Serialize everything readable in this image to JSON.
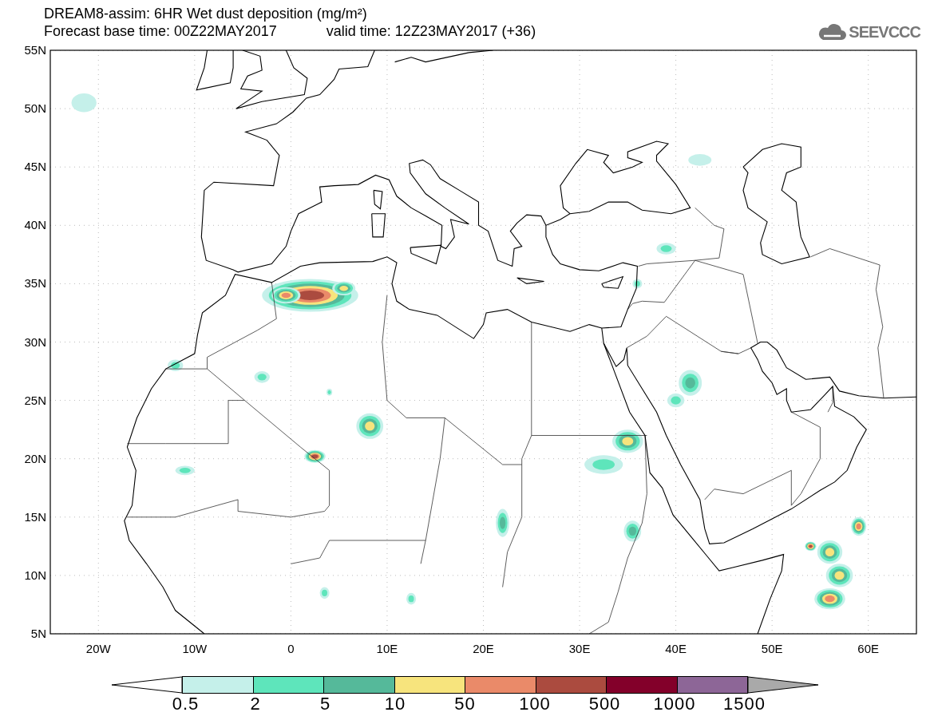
{
  "header": {
    "title": "DREAM8-assim: 6HR Wet dust deposition (mg/m²)",
    "base_time": "Forecast base time: 00Z22MAY2017",
    "valid_time": "valid time: 12Z23MAY2017 (+36)",
    "logo": "SEEVCCC"
  },
  "map": {
    "y_ticks": [
      "55N",
      "50N",
      "45N",
      "40N",
      "35N",
      "30N",
      "25N",
      "20N",
      "15N",
      "10N",
      "5N"
    ],
    "x_ticks": [
      "20W",
      "10W",
      "0",
      "10E",
      "20E",
      "30E",
      "40E",
      "50E",
      "60E"
    ]
  },
  "colorbar": {
    "bins": [
      {
        "color": "#ffffff"
      },
      {
        "color": "#c5f0ea"
      },
      {
        "color": "#5ee5bb"
      },
      {
        "color": "#55b99a"
      },
      {
        "color": "#f7e47d"
      },
      {
        "color": "#ea8a69"
      },
      {
        "color": "#ab4b3f"
      },
      {
        "color": "#83002a"
      },
      {
        "color": "#8d6697"
      },
      {
        "color": "#a9a9a9"
      }
    ],
    "labels": [
      "0.5",
      "2",
      "5",
      "10",
      "50",
      "100",
      "500",
      "1000",
      "1500"
    ]
  }
}
